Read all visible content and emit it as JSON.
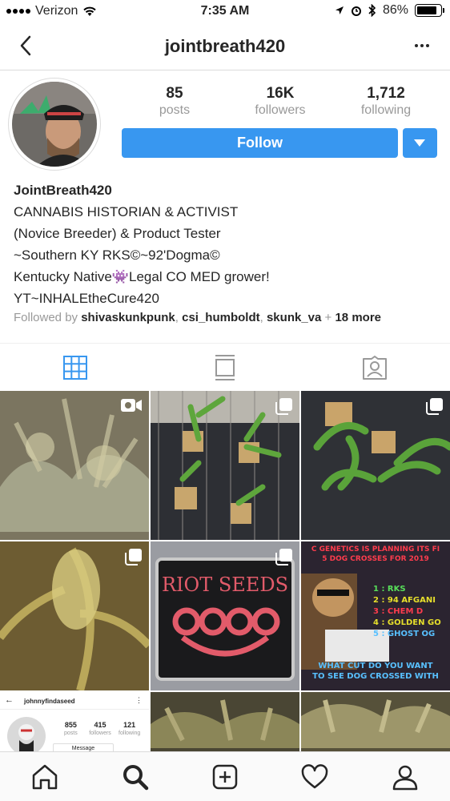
{
  "status_bar": {
    "carrier": "Verizon",
    "time": "7:35 AM",
    "battery": "86%",
    "battery_level": 0.86
  },
  "nav": {
    "title": "jointbreath420",
    "back_icon": "chevron-left-icon",
    "more_icon": "more-horizontal-icon"
  },
  "profile": {
    "stats": [
      {
        "num": "85",
        "label": "posts"
      },
      {
        "num": "16K",
        "label": "followers"
      },
      {
        "num": "1,712",
        "label": "following"
      }
    ],
    "follow_label": "Follow",
    "bio": {
      "name": "JointBreath420",
      "lines": [
        "CANNABIS HISTORIAN & ACTIVIST",
        "(Novice Breeder) & Product Tester",
        "~Southern KY RKS©~92'Dogma©",
        "Kentucky Native👾Legal CO MED grower!",
        "YT~INHALEtheCure420"
      ]
    },
    "followed_by": {
      "prefix": "Followed by ",
      "users": [
        "shivaskunkpunk",
        "csi_humboldt",
        "skunk_va"
      ],
      "sep": ", ",
      "plus": " + ",
      "more": "18 more"
    }
  },
  "tabs": [
    "grid-icon",
    "feed-icon",
    "tagged-icon"
  ],
  "posts": {
    "riot_text": "RIOT SEEDS",
    "meme": {
      "top": "C GENETICS IS PLANNING ITS FI",
      "top2": "5 DOG CROSSES FOR 2019",
      "items": [
        "1 : RKS",
        "2 : 94 AFGANI",
        "3 : CHEM D",
        "4 : GOLDEN GO",
        "5 : GHOST OG"
      ],
      "bottom": "WHAT CUT DO YOU WANT",
      "bottom2": "TO SEE DOG CROSSED WITH"
    },
    "mini_profile": {
      "username": "johnnyfindaseed",
      "stats": [
        {
          "num": "855",
          "label": "posts"
        },
        {
          "num": "415",
          "label": "followers"
        },
        {
          "num": "121",
          "label": "following"
        }
      ],
      "message": "Message"
    }
  },
  "bottom_bar": [
    "home-icon",
    "search-icon",
    "new-post-icon",
    "activity-heart-icon",
    "profile-icon"
  ],
  "colors": {
    "accent": "#3897f0",
    "text": "#262626",
    "muted": "#999999",
    "border": "#dbdbdb"
  }
}
